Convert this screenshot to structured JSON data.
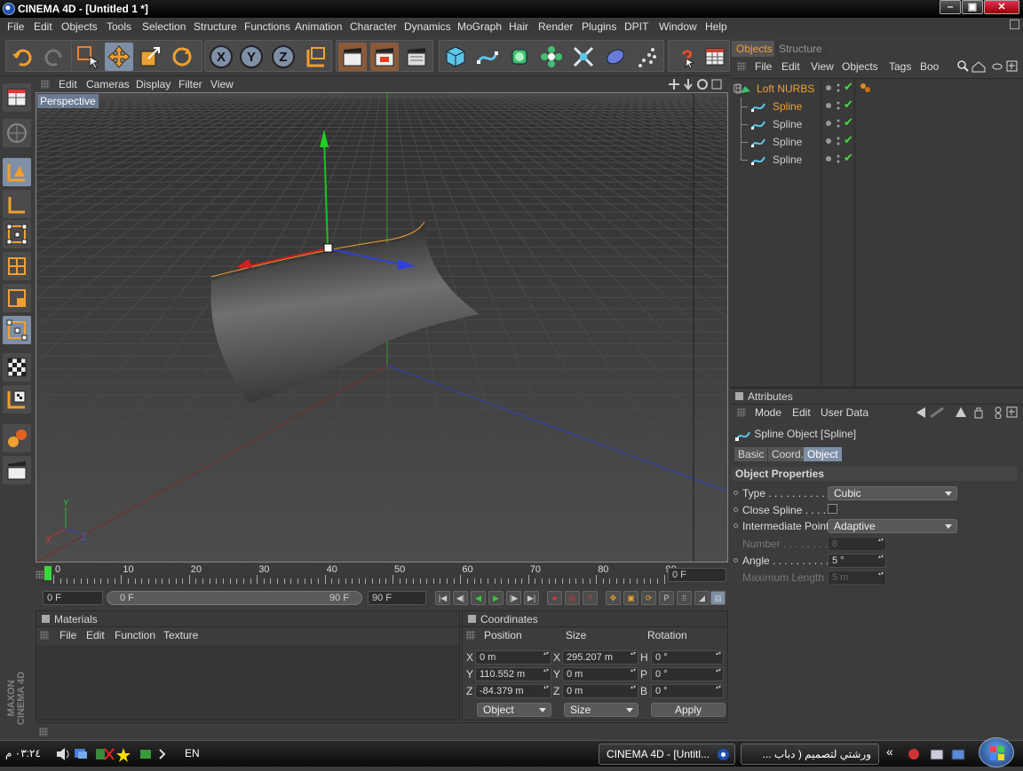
{
  "window": {
    "title": "CINEMA 4D - [Untitled 1 *]",
    "min": "‒",
    "max": "▣",
    "close": "✕"
  },
  "menu": [
    "File",
    "Edit",
    "Objects",
    "Tools",
    "Selection",
    "Structure",
    "Functions",
    "Animation",
    "Character",
    "Dynamics",
    "MoGraph",
    "Hair",
    "Render",
    "Plugins",
    "DPIT",
    "Window",
    "Help"
  ],
  "toolbar": {
    "x": "X",
    "y": "Y",
    "z": "Z"
  },
  "viewport": {
    "menu": [
      "Edit",
      "Cameras",
      "Display",
      "Filter",
      "View"
    ],
    "label": "Perspective",
    "axis_x": "X",
    "axis_y": "Y",
    "axis_z": "Z"
  },
  "timeline": {
    "ticks": [
      "0",
      "10",
      "20",
      "30",
      "40",
      "50",
      "60",
      "70",
      "80",
      "90"
    ],
    "current": "0 F"
  },
  "playback": {
    "start": "0 F",
    "range_start": "0 F",
    "range_end": "90 F",
    "end": "90 F"
  },
  "materials": {
    "title": "Materials",
    "menu": [
      "File",
      "Edit",
      "Function",
      "Texture"
    ]
  },
  "coordinates": {
    "title": "Coordinates",
    "headers": [
      "Position",
      "Size",
      "Rotation"
    ],
    "rows": [
      {
        "l1": "X",
        "p": "0 m",
        "l2": "X",
        "s": "295.207 m",
        "l3": "H",
        "r": "0 °"
      },
      {
        "l1": "Y",
        "p": "110.552 m",
        "l2": "Y",
        "s": "0 m",
        "l3": "P",
        "r": "0 °"
      },
      {
        "l1": "Z",
        "p": "-84.379 m",
        "l2": "Z",
        "s": "0 m",
        "l3": "B",
        "r": "0 °"
      }
    ],
    "mode": "Object",
    "sizemode": "Size",
    "apply": "Apply"
  },
  "objects": {
    "tabs": [
      "Objects",
      "Structure"
    ],
    "menu": [
      "File",
      "Edit",
      "View",
      "Objects",
      "Tags",
      "Boo"
    ],
    "items": [
      {
        "name": "Loft NURBS",
        "level": 0
      },
      {
        "name": "Spline",
        "level": 1
      },
      {
        "name": "Spline",
        "level": 1
      },
      {
        "name": "Spline",
        "level": 1
      },
      {
        "name": "Spline",
        "level": 1
      }
    ]
  },
  "attributes": {
    "title": "Attributes",
    "menu": [
      "Mode",
      "Edit",
      "User Data"
    ],
    "object_title": "Spline Object [Spline]",
    "tabs": [
      "Basic",
      "Coord.",
      "Object"
    ],
    "section": "Object Properties",
    "props": [
      {
        "label": "Type . . . . . . . . . . .",
        "value": "Cubic",
        "kind": "dropdown"
      },
      {
        "label": "Close Spline . . . . .",
        "value": "",
        "kind": "check"
      },
      {
        "label": "Intermediate Points",
        "value": "Adaptive",
        "kind": "dropdown"
      },
      {
        "label": "Number . . . . . . . .",
        "value": "8",
        "kind": "spin",
        "disabled": true
      },
      {
        "label": "Angle . . . . . . . . . .",
        "value": "5 °",
        "kind": "spin"
      },
      {
        "label": "Maximum Length",
        "value": "5 m",
        "kind": "spin",
        "disabled": true
      }
    ]
  },
  "logo": {
    "line1": "MAXON",
    "line2": "CINEMA 4D"
  },
  "taskbar": {
    "clock": "٠٣:٢٤ م",
    "lang": "EN",
    "task1": "CINEMA 4D - [Untitl...",
    "task2": "ورشتي لتصميم ( دباب ..."
  },
  "colors": {
    "accent_orange": "#ff9a1a",
    "selection_blue": "#7e8fa6",
    "grid": "#4a4a4a",
    "bg": "#3c3c3c"
  }
}
